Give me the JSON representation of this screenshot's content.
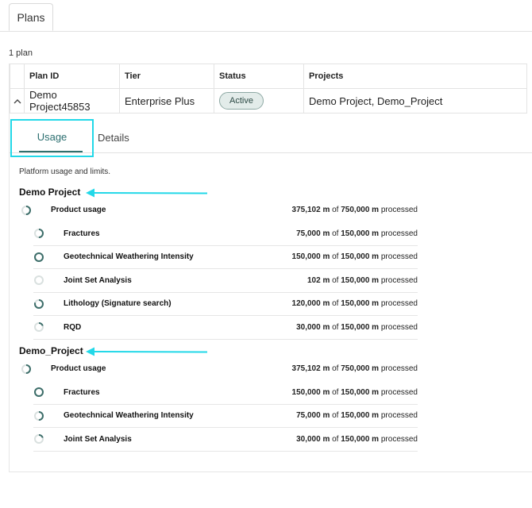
{
  "tabs": {
    "plans": "Plans"
  },
  "plan_count": "1 plan",
  "table": {
    "headers": [
      "Plan ID",
      "Tier",
      "Status",
      "Projects"
    ],
    "row": {
      "plan_id": "Demo Project45853",
      "tier": "Enterprise Plus",
      "status": "Active",
      "projects": "Demo Project, Demo_Project"
    }
  },
  "subtabs": {
    "usage": "Usage",
    "details": "Details"
  },
  "intro": "Platform usage and limits.",
  "projects": [
    {
      "title": "Demo Project",
      "summary": {
        "name": "Product usage",
        "used": "375,102 m",
        "of": "of",
        "limit": "750,000 m",
        "suffix": "processed",
        "fraction": 0.5
      },
      "items": [
        {
          "name": "Fractures",
          "used": "75,000 m",
          "of": "of",
          "limit": "150,000 m",
          "suffix": "processed",
          "fraction": 0.5
        },
        {
          "name": "Geotechnical Weathering Intensity",
          "used": "150,000 m",
          "of": "of",
          "limit": "150,000 m",
          "suffix": "processed",
          "fraction": 1.0
        },
        {
          "name": "Joint Set Analysis",
          "used": "102 m",
          "of": "of",
          "limit": "150,000 m",
          "suffix": "processed",
          "fraction": 0.0
        },
        {
          "name": "Lithology (Signature search)",
          "used": "120,000 m",
          "of": "of",
          "limit": "150,000 m",
          "suffix": "processed",
          "fraction": 0.8
        },
        {
          "name": "RQD",
          "used": "30,000 m",
          "of": "of",
          "limit": "150,000 m",
          "suffix": "processed",
          "fraction": 0.2
        }
      ]
    },
    {
      "title": "Demo_Project",
      "summary": {
        "name": "Product usage",
        "used": "375,102 m",
        "of": "of",
        "limit": "750,000 m",
        "suffix": "processed",
        "fraction": 0.5
      },
      "items": [
        {
          "name": "Fractures",
          "used": "150,000 m",
          "of": "of",
          "limit": "150,000 m",
          "suffix": "processed",
          "fraction": 1.0
        },
        {
          "name": "Geotechnical Weathering Intensity",
          "used": "75,000 m",
          "of": "of",
          "limit": "150,000 m",
          "suffix": "processed",
          "fraction": 0.5
        },
        {
          "name": "Joint Set Analysis",
          "used": "30,000 m",
          "of": "of",
          "limit": "150,000 m",
          "suffix": "processed",
          "fraction": 0.2
        }
      ]
    }
  ],
  "colors": {
    "ring_fill": "#3d6e6a",
    "ring_track": "#d9e0df",
    "annotation": "#22d8e8",
    "accent": "#2f6f6c"
  },
  "icons": {
    "expand": "chevron-up-icon",
    "progress": "progress-ring-icon",
    "annotation": "arrow-left-icon"
  }
}
